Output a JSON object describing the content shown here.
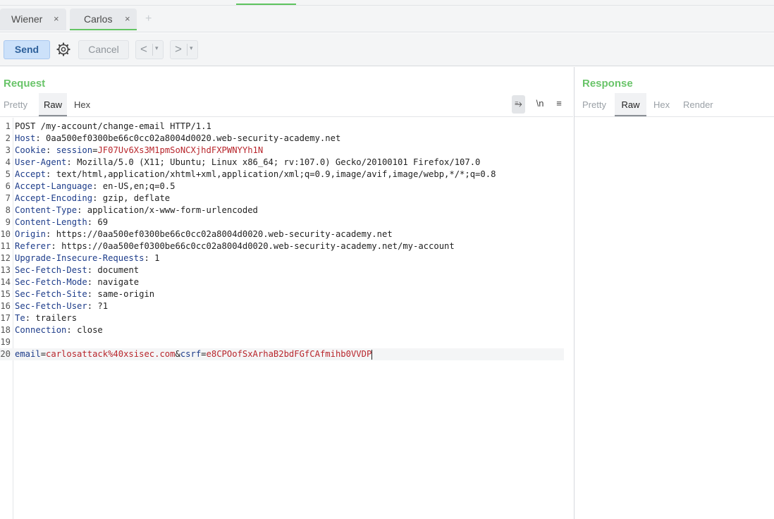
{
  "tabs": [
    {
      "label": "Wiener",
      "close": "×"
    },
    {
      "label": "Carlos",
      "close": "×"
    }
  ],
  "new_tab_symbol": "+",
  "toolbar": {
    "send_label": "Send",
    "cancel_label": "Cancel",
    "back_symbol": "<",
    "forward_symbol": ">",
    "dropdown_symbol": "▾"
  },
  "request": {
    "title": "Request",
    "subtabs": [
      "Pretty",
      "Raw",
      "Hex"
    ],
    "active_subtab": "Raw",
    "tools": {
      "wrap": "⥱",
      "newline": "\\n",
      "menu": "≡"
    },
    "lines": [
      {
        "n": "1",
        "key": "",
        "sep": "",
        "value": "POST /my-account/change-email HTTP/1.1"
      },
      {
        "n": "2",
        "key": "Host",
        "sep": ": ",
        "value": "0aa500ef0300be66c0cc02a8004d0020.web-security-academy.net"
      },
      {
        "n": "3",
        "key": "Cookie",
        "sep": ": ",
        "cookie_name": "session",
        "cookie_value": "JF07Uv6Xs3M1pmSoNCXjhdFXPWNYYh1N"
      },
      {
        "n": "4",
        "key": "User-Agent",
        "sep": ": ",
        "value": "Mozilla/5.0 (X11; Ubuntu; Linux x86_64; rv:107.0) Gecko/20100101 Firefox/107.0"
      },
      {
        "n": "5",
        "key": "Accept",
        "sep": ": ",
        "value": "text/html,application/xhtml+xml,application/xml;q=0.9,image/avif,image/webp,*/*;q=0.8"
      },
      {
        "n": "6",
        "key": "Accept-Language",
        "sep": ": ",
        "value": "en-US,en;q=0.5"
      },
      {
        "n": "7",
        "key": "Accept-Encoding",
        "sep": ": ",
        "value": "gzip, deflate"
      },
      {
        "n": "8",
        "key": "Content-Type",
        "sep": ": ",
        "value": "application/x-www-form-urlencoded"
      },
      {
        "n": "9",
        "key": "Content-Length",
        "sep": ": ",
        "value": "69"
      },
      {
        "n": "10",
        "key": "Origin",
        "sep": ": ",
        "value": "https://0aa500ef0300be66c0cc02a8004d0020.web-security-academy.net"
      },
      {
        "n": "11",
        "key": "Referer",
        "sep": ": ",
        "value": "https://0aa500ef0300be66c0cc02a8004d0020.web-security-academy.net/my-account"
      },
      {
        "n": "12",
        "key": "Upgrade-Insecure-Requests",
        "sep": ": ",
        "value": "1"
      },
      {
        "n": "13",
        "key": "Sec-Fetch-Dest",
        "sep": ": ",
        "value": "document"
      },
      {
        "n": "14",
        "key": "Sec-Fetch-Mode",
        "sep": ": ",
        "value": "navigate"
      },
      {
        "n": "15",
        "key": "Sec-Fetch-Site",
        "sep": ": ",
        "value": "same-origin"
      },
      {
        "n": "16",
        "key": "Sec-Fetch-User",
        "sep": ": ",
        "value": "?1"
      },
      {
        "n": "17",
        "key": "Te",
        "sep": ": ",
        "value": "trailers"
      },
      {
        "n": "18",
        "key": "Connection",
        "sep": ": ",
        "value": "close"
      },
      {
        "n": "19",
        "key": "",
        "sep": "",
        "value": ""
      }
    ],
    "body_line": {
      "n": "20",
      "param1_name": "email",
      "param1_value": "carlosattack%40xsisec.com",
      "amp": "&",
      "param2_name": "csrf",
      "param2_value": "e8CPOofSxArhaB2bdFGfCAfmihb0VVDP",
      "eq": "="
    }
  },
  "response": {
    "title": "Response",
    "subtabs": [
      "Pretty",
      "Raw",
      "Hex",
      "Render"
    ],
    "active_subtab": "Raw"
  },
  "colors": {
    "accent_green": "#69c469",
    "header_key": "#1d3c8a",
    "param_value": "#b8262c",
    "send_bg": "#cce1fa"
  }
}
